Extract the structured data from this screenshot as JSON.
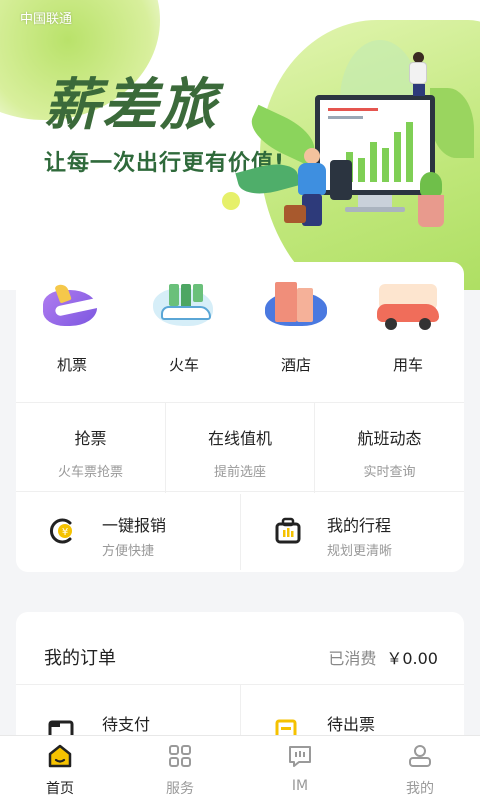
{
  "status_bar": {
    "carrier": "中国联通"
  },
  "hero": {
    "brand": "薪差旅",
    "slogan": "让每一次出行更有价值!"
  },
  "categories": [
    {
      "label": "机票",
      "icon": "plane-icon"
    },
    {
      "label": "火车",
      "icon": "train-icon"
    },
    {
      "label": "酒店",
      "icon": "hotel-icon"
    },
    {
      "label": "用车",
      "icon": "car-icon"
    }
  ],
  "quick_services": [
    {
      "title": "抢票",
      "subtitle": "火车票抢票"
    },
    {
      "title": "在线值机",
      "subtitle": "提前选座"
    },
    {
      "title": "航班动态",
      "subtitle": "实时查询"
    }
  ],
  "features": [
    {
      "title": "一键报销",
      "subtitle": "方便快捷",
      "icon": "reimburse-icon"
    },
    {
      "title": "我的行程",
      "subtitle": "规划更清晰",
      "icon": "itinerary-icon"
    }
  ],
  "orders": {
    "title": "我的订单",
    "spent_label": "已消费",
    "spent_amount": "￥0.00",
    "items": [
      {
        "label": "待支付",
        "icon": "pending-payment-icon"
      },
      {
        "label": "待出票",
        "icon": "pending-ticket-icon"
      }
    ]
  },
  "tabbar": [
    {
      "label": "首页",
      "icon": "home-icon",
      "active": true
    },
    {
      "label": "服务",
      "icon": "services-icon",
      "active": false
    },
    {
      "label": "IM",
      "icon": "chat-icon",
      "active": false
    },
    {
      "label": "我的",
      "icon": "profile-icon",
      "active": false
    }
  ],
  "colors": {
    "accent": "#7fcf55",
    "brand_text": "#3b6a3a",
    "subtle_text": "#999999",
    "icon_yellow": "#f5c200"
  }
}
